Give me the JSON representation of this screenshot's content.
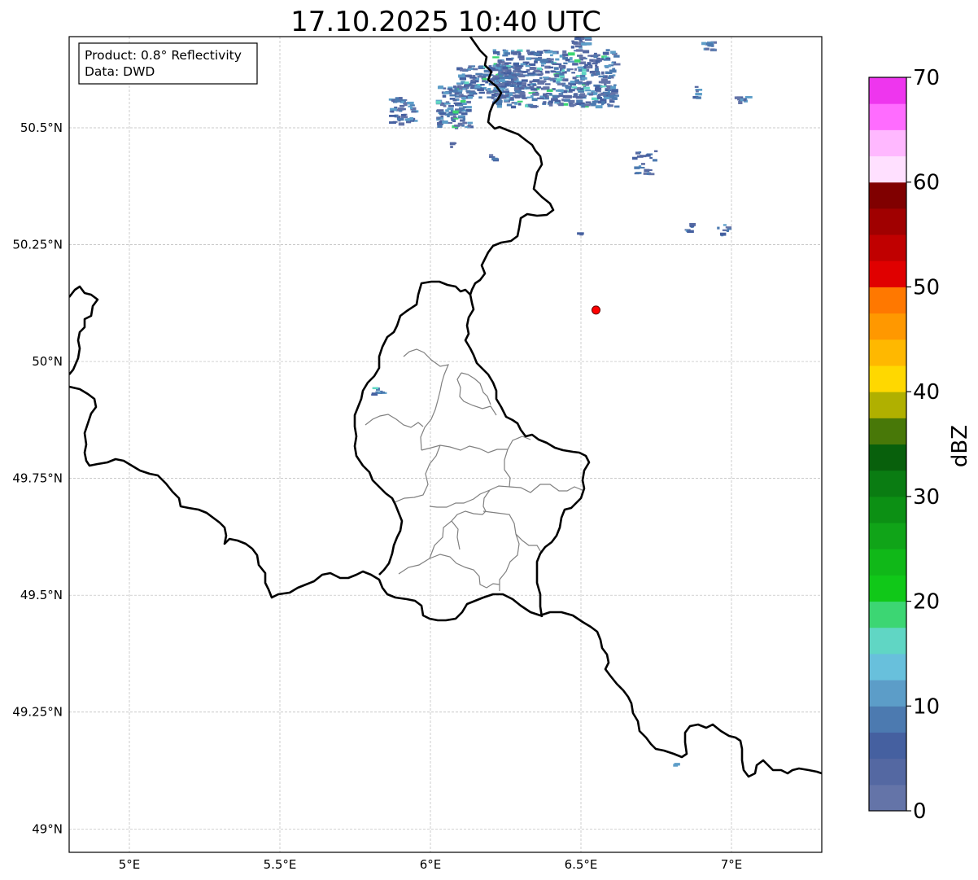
{
  "title": "17.10.2025 10:40 UTC",
  "info_box": {
    "line1": "Product: 0.8° Reflectivity",
    "line2": "Data: DWD"
  },
  "map": {
    "lon_range": [
      4.8,
      7.3
    ],
    "lat_range": [
      48.95,
      50.695
    ],
    "x_ticks": [
      {
        "value": 5.0,
        "label": "5°E"
      },
      {
        "value": 5.5,
        "label": "5.5°E"
      },
      {
        "value": 6.0,
        "label": "6°E"
      },
      {
        "value": 6.5,
        "label": "6.5°E"
      },
      {
        "value": 7.0,
        "label": "7°E"
      }
    ],
    "y_ticks": [
      {
        "value": 50.5,
        "label": "50.5°N"
      },
      {
        "value": 50.25,
        "label": "50.25°N"
      },
      {
        "value": 50.0,
        "label": "50°N"
      },
      {
        "value": 49.75,
        "label": "49.75°N"
      },
      {
        "value": 49.5,
        "label": "49.5°N"
      },
      {
        "value": 49.25,
        "label": "49.25°N"
      },
      {
        "value": 49.0,
        "label": "49°N"
      }
    ],
    "grid": true,
    "radar_site": {
      "lon": 6.55,
      "lat": 50.11,
      "color": "#ff0000"
    }
  },
  "colorbar": {
    "label": "dBZ",
    "min": 0,
    "max": 70,
    "step": 2.5,
    "tick_labels": [
      "0",
      "10",
      "20",
      "30",
      "40",
      "50",
      "60",
      "70"
    ],
    "colors": [
      "#6474a8",
      "#5468a2",
      "#4560a0",
      "#4c7ab0",
      "#5c9dc8",
      "#68c0dc",
      "#60d6c4",
      "#3cd673",
      "#10c818",
      "#10b818",
      "#10a418",
      "#0c9014",
      "#0a7c12",
      "#08600c",
      "#487808",
      "#b0b000",
      "#ffd800",
      "#ffb800",
      "#ff9800",
      "#ff7800",
      "#e00000",
      "#c00000",
      "#a00000",
      "#800000",
      "#ffe0ff",
      "#ffb8ff",
      "#ff6cff",
      "#ee36ee"
    ]
  }
}
